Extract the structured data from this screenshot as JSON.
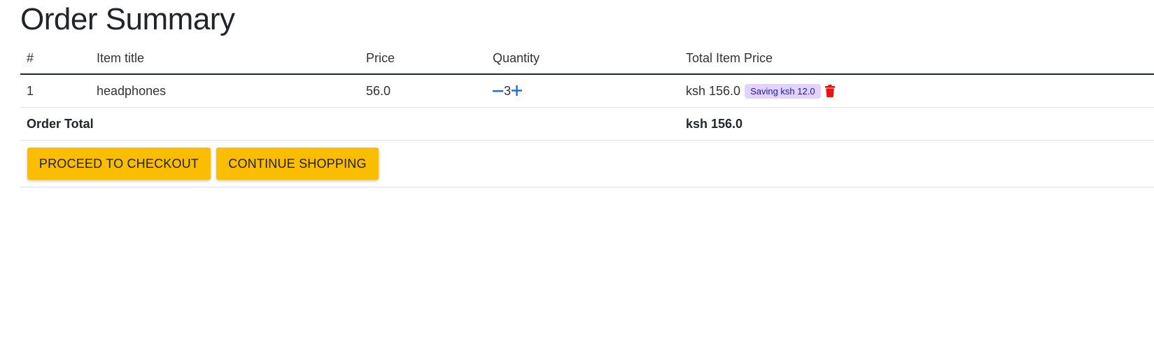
{
  "page": {
    "title": "Order Summary"
  },
  "table": {
    "headers": [
      "#",
      "Item title",
      "Price",
      "Quantity",
      "Total Item Price"
    ],
    "items": [
      {
        "index": "1",
        "title": "headphones",
        "price": "56.0",
        "quantity": "3",
        "total": "ksh 156.0",
        "saving": "Saving ksh 12.0"
      }
    ],
    "order_total_label": "Order Total",
    "order_total_value": "ksh 156.0"
  },
  "actions": {
    "checkout_label": "PROCEED TO CHECKOUT",
    "continue_label": "CONTINUE SHOPPING"
  },
  "icons": {
    "minus": "minus-icon",
    "plus": "plus-icon",
    "delete": "trash-icon"
  },
  "colors": {
    "button_bg": "#fbbd00",
    "qty_controls": "#1a6be0",
    "badge_bg": "#e3d2fb",
    "badge_text": "#1a1aa6",
    "delete_icon": "#ee1111"
  }
}
